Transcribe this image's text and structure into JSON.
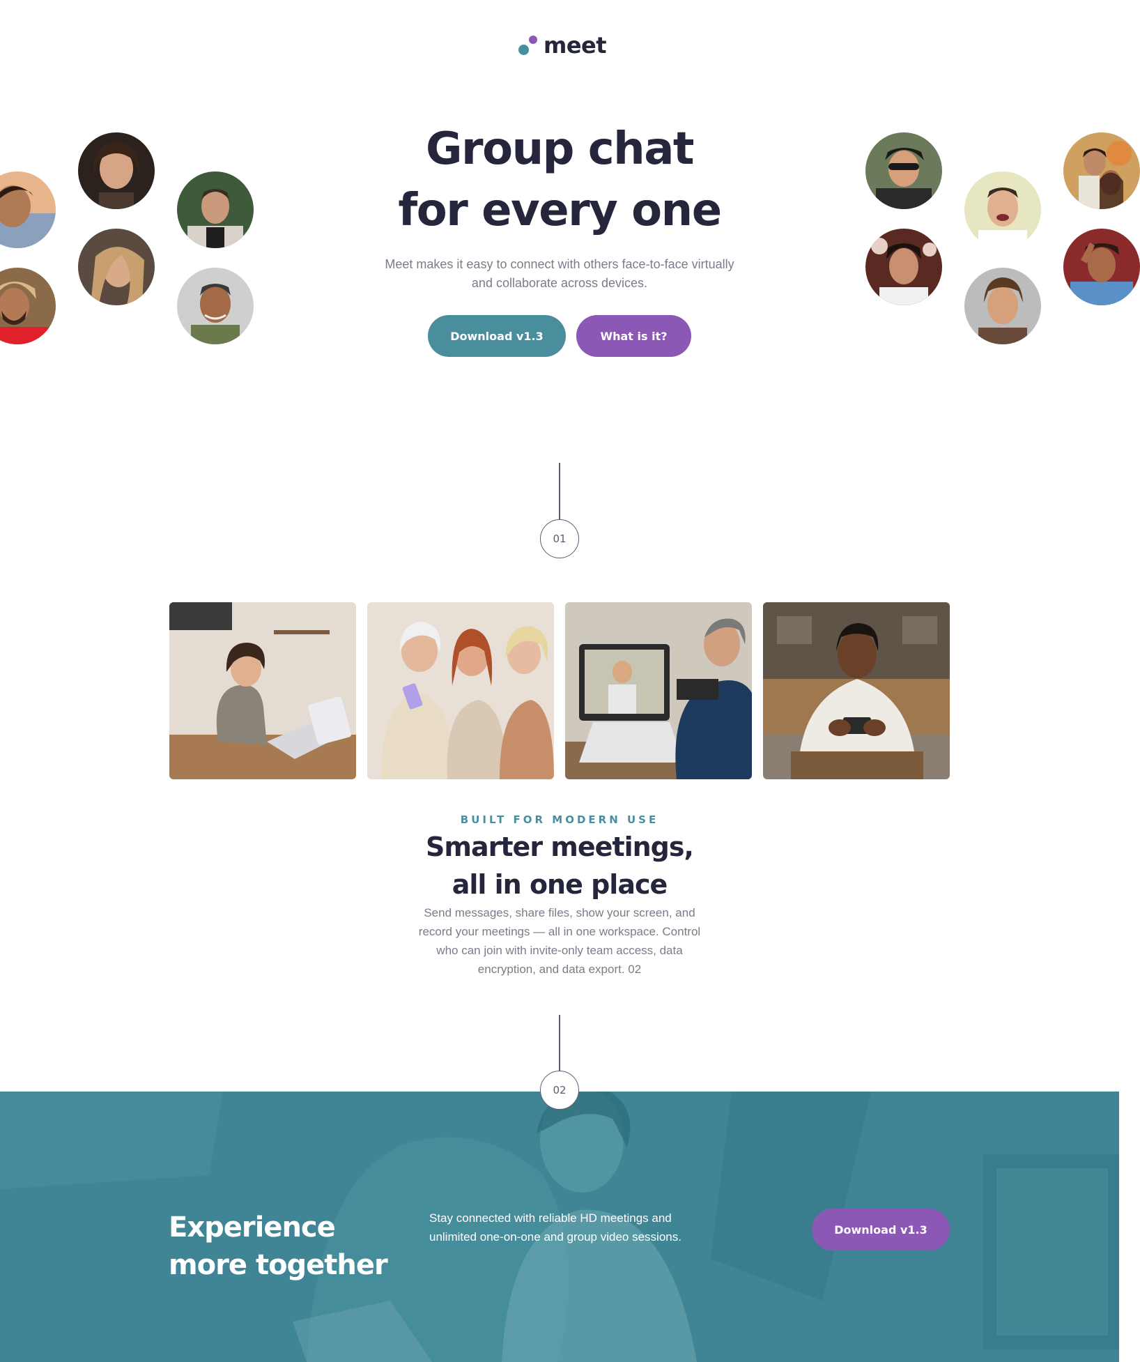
{
  "brand": {
    "name": "meet"
  },
  "hero": {
    "title_line1": "Group chat",
    "title_line2": "for every one",
    "subtitle": "Meet makes it easy to connect with others face-to-face virtually and collaborate across devices.",
    "primary_button": "Download v1.3",
    "secondary_button": "What is it?"
  },
  "steps": {
    "first": "01",
    "second": "02"
  },
  "features": {
    "eyebrow": "BUILT FOR MODERN USE",
    "title": "Smarter meetings, all in one place",
    "description": "Send messages, share files, show your screen, and record your meetings — all in one workspace. Control who can join with invite-only team access, data encryption, and data export. 02"
  },
  "cta": {
    "title": "Experience more together",
    "description": "Stay connected with reliable HD meetings and unlimited one-on-one and group video sessions.",
    "button": "Download v1.3"
  },
  "colors": {
    "primary_text": "#25263b",
    "muted_text": "#7a7c8a",
    "teal": "#4a8e9e",
    "purple": "#8c58b5",
    "banner_overlay": "#3f8595"
  }
}
